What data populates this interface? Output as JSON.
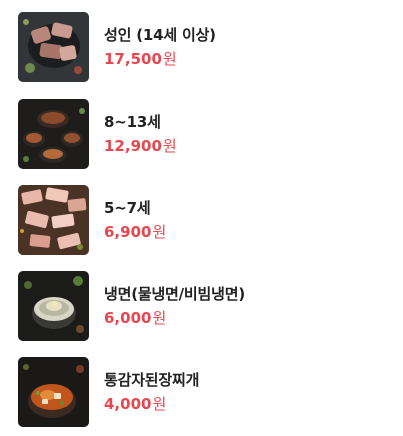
{
  "menu": {
    "items": [
      {
        "name": "성인 (14세 이상)",
        "price": "17,500",
        "unit": "원",
        "image_icon": "grilled-meat-platter-image"
      },
      {
        "name": "8~13세",
        "price": "12,900",
        "unit": "원",
        "image_icon": "korean-bbq-dishes-image"
      },
      {
        "name": "5~7세",
        "price": "6,900",
        "unit": "원",
        "image_icon": "raw-pork-belly-image"
      },
      {
        "name": "냉면(물냉면/비빔냉면)",
        "price": "6,000",
        "unit": "원",
        "image_icon": "cold-noodle-bowl-image"
      },
      {
        "name": "통감자된장찌개",
        "price": "4,000",
        "unit": "원",
        "image_icon": "doenjang-stew-image"
      }
    ]
  },
  "colors": {
    "price": "#e8474f",
    "name": "#222222"
  }
}
